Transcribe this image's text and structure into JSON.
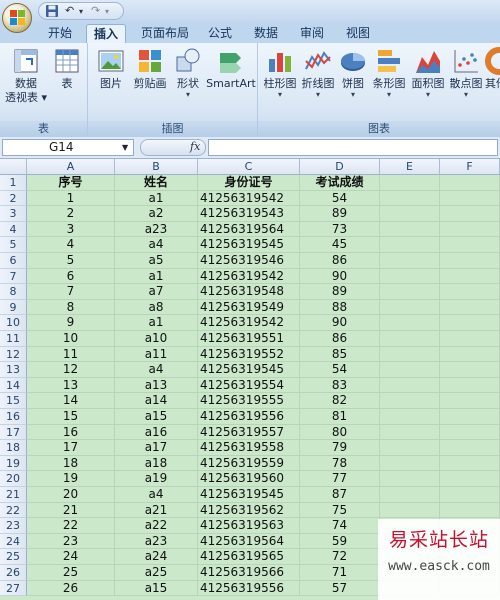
{
  "qat": {
    "save_icon": "save-icon",
    "undo": "↶",
    "redo": "↷"
  },
  "tabs": [
    "开始",
    "插入",
    "页面布局",
    "公式",
    "数据",
    "审阅",
    "视图"
  ],
  "active_tab": "插入",
  "ribbon": {
    "table_group": {
      "label": "表",
      "pivot_line1": "数据",
      "pivot_line2": "透视表",
      "table": "表"
    },
    "illustration_group": {
      "label": "插图",
      "picture": "图片",
      "clipart": "剪贴画",
      "shapes": "形状",
      "smartart": "SmartArt"
    },
    "chart_group": {
      "label": "图表",
      "column": "柱形图",
      "line": "折线图",
      "pie": "饼图",
      "bar": "条形图",
      "area": "面积图",
      "scatter": "散点图",
      "other": "其他"
    }
  },
  "formula_bar": {
    "name_box": "G14",
    "fx": "fx",
    "formula": ""
  },
  "columns": [
    "A",
    "B",
    "C",
    "D",
    "E",
    "F"
  ],
  "rows": [
    {
      "n": "1",
      "a": "序号",
      "b": "姓名",
      "c": "身份证号",
      "d": "考试成绩"
    },
    {
      "n": "2",
      "a": "1",
      "b": "a1",
      "c": "41256319542",
      "d": "54"
    },
    {
      "n": "3",
      "a": "2",
      "b": "a2",
      "c": "41256319543",
      "d": "89"
    },
    {
      "n": "4",
      "a": "3",
      "b": "a23",
      "c": "41256319564",
      "d": "73"
    },
    {
      "n": "5",
      "a": "4",
      "b": "a4",
      "c": "41256319545",
      "d": "45"
    },
    {
      "n": "6",
      "a": "5",
      "b": "a5",
      "c": "41256319546",
      "d": "86"
    },
    {
      "n": "7",
      "a": "6",
      "b": "a1",
      "c": "41256319542",
      "d": "90"
    },
    {
      "n": "8",
      "a": "7",
      "b": "a7",
      "c": "41256319548",
      "d": "89"
    },
    {
      "n": "9",
      "a": "8",
      "b": "a8",
      "c": "41256319549",
      "d": "88"
    },
    {
      "n": "10",
      "a": "9",
      "b": "a1",
      "c": "41256319542",
      "d": "90"
    },
    {
      "n": "11",
      "a": "10",
      "b": "a10",
      "c": "41256319551",
      "d": "86"
    },
    {
      "n": "12",
      "a": "11",
      "b": "a11",
      "c": "41256319552",
      "d": "85"
    },
    {
      "n": "13",
      "a": "12",
      "b": "a4",
      "c": "41256319545",
      "d": "54"
    },
    {
      "n": "14",
      "a": "13",
      "b": "a13",
      "c": "41256319554",
      "d": "83"
    },
    {
      "n": "15",
      "a": "14",
      "b": "a14",
      "c": "41256319555",
      "d": "82"
    },
    {
      "n": "16",
      "a": "15",
      "b": "a15",
      "c": "41256319556",
      "d": "81"
    },
    {
      "n": "17",
      "a": "16",
      "b": "a16",
      "c": "41256319557",
      "d": "80"
    },
    {
      "n": "18",
      "a": "17",
      "b": "a17",
      "c": "41256319558",
      "d": "79"
    },
    {
      "n": "19",
      "a": "18",
      "b": "a18",
      "c": "41256319559",
      "d": "78"
    },
    {
      "n": "20",
      "a": "19",
      "b": "a19",
      "c": "41256319560",
      "d": "77"
    },
    {
      "n": "21",
      "a": "20",
      "b": "a4",
      "c": "41256319545",
      "d": "87"
    },
    {
      "n": "22",
      "a": "21",
      "b": "a21",
      "c": "41256319562",
      "d": "75"
    },
    {
      "n": "23",
      "a": "22",
      "b": "a22",
      "c": "41256319563",
      "d": "74"
    },
    {
      "n": "24",
      "a": "23",
      "b": "a23",
      "c": "41256319564",
      "d": "59"
    },
    {
      "n": "25",
      "a": "24",
      "b": "a24",
      "c": "41256319565",
      "d": "72"
    },
    {
      "n": "26",
      "a": "25",
      "b": "a25",
      "c": "41256319566",
      "d": "71"
    },
    {
      "n": "27",
      "a": "26",
      "b": "a15",
      "c": "41256319556",
      "d": "57"
    }
  ],
  "watermark": {
    "title": "易采站长站",
    "url": "www.easck.com"
  },
  "colors": {
    "sheet_bg": "#cbe8cb",
    "ribbon_bg": "#dde9f6",
    "watermark_red": "#c8102e"
  }
}
